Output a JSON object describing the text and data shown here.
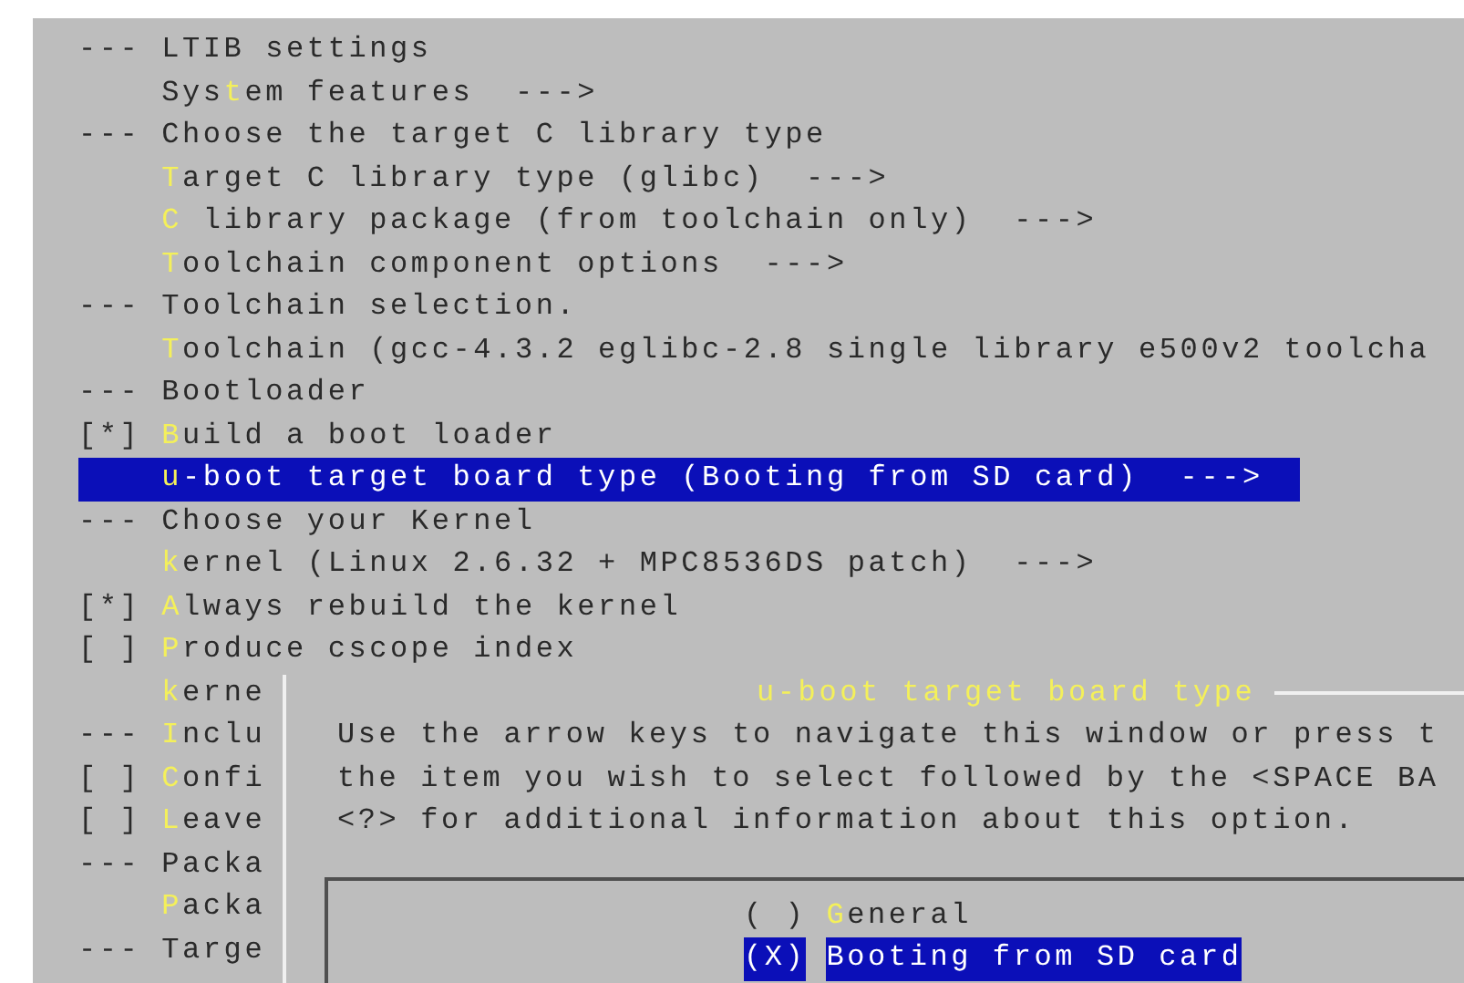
{
  "menu": {
    "rows": [
      {
        "text": "--- LTIB settings",
        "selected": false
      },
      {
        "text": "    Sys**t**em features  --->",
        "selected": false
      },
      {
        "text": "--- Choose the target C library type",
        "selected": false
      },
      {
        "text": "    **T**arget C library type (glibc)  --->",
        "selected": false
      },
      {
        "text": "    **C** library package (from toolchain only)  --->",
        "selected": false
      },
      {
        "text": "    **T**oolchain component options  --->",
        "selected": false
      },
      {
        "text": "--- Toolchain selection.",
        "selected": false
      },
      {
        "text": "    **T**oolchain (gcc-4.3.2 eglibc-2.8 single library e500v2 toolcha",
        "selected": false
      },
      {
        "text": "--- Bootloader",
        "selected": false
      },
      {
        "text": "[*] **B**uild a boot loader",
        "selected": false
      },
      {
        "text": "    **u**-boot target board type (Booting from SD card)  --->",
        "selected": true
      },
      {
        "text": "--- Choose your Kernel",
        "selected": false
      },
      {
        "text": "    **k**ernel (Linux 2.6.32 + MPC8536DS patch)  --->",
        "selected": false
      },
      {
        "text": "[*] **A**lways rebuild the kernel",
        "selected": false
      },
      {
        "text": "[ ] **P**roduce cscope index",
        "selected": false
      },
      {
        "text": "    **k**erne",
        "selected": false
      },
      {
        "text": "--- **I**nclu",
        "selected": false
      },
      {
        "text": "[ ] **C**onfi",
        "selected": false
      },
      {
        "text": "[ ] **L**eave",
        "selected": false
      },
      {
        "text": "--- Packa",
        "selected": false
      },
      {
        "text": "    **P**acka",
        "selected": false
      },
      {
        "text": "--- Targe",
        "selected": false
      }
    ]
  },
  "dialog": {
    "title": "u-boot target board type",
    "help": [
      "Use the arrow keys to navigate this window or press t",
      "the item you wish to select followed by the <SPACE BA",
      "<?> for additional information about this option."
    ],
    "options": [
      {
        "marker": "( )",
        "label": "**G**eneral",
        "selected": false
      },
      {
        "marker": "(X)",
        "label": "Booting from SD card",
        "selected": true
      }
    ]
  }
}
